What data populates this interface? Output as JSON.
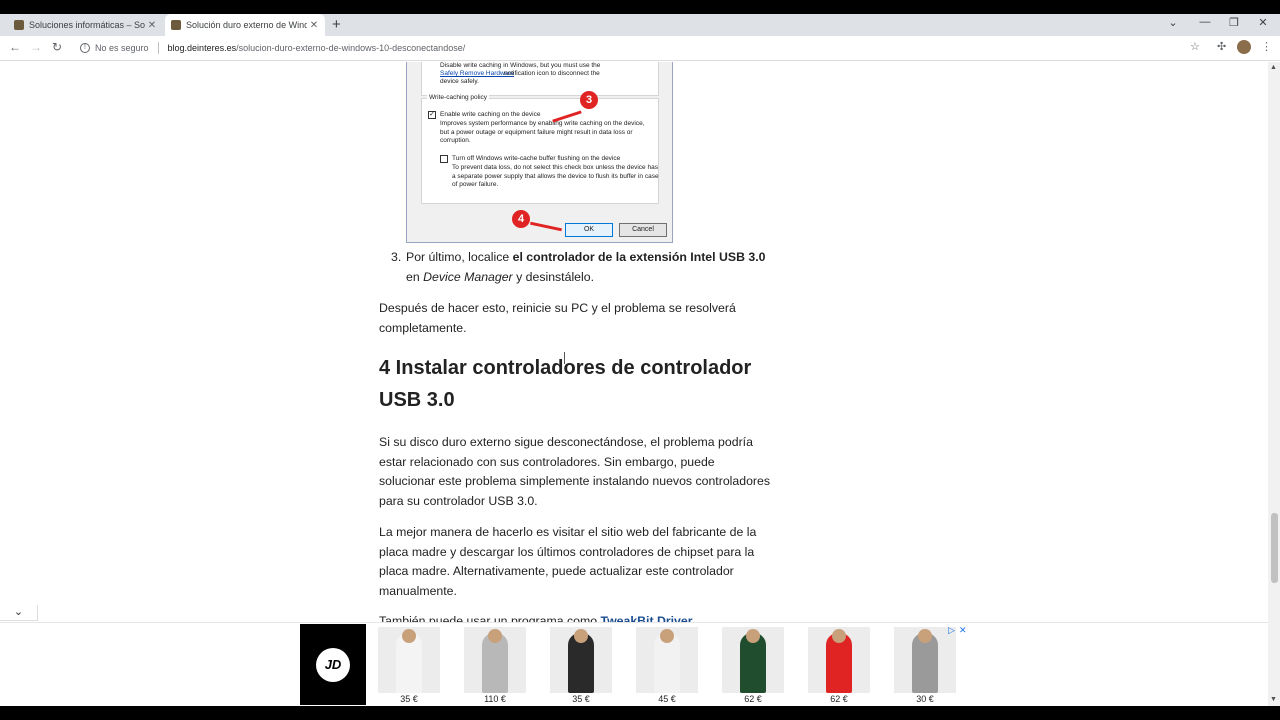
{
  "browser": {
    "tabs": [
      {
        "title": "Soluciones informáticas – Solucio"
      },
      {
        "title": "Solución duro externo de Windo"
      }
    ],
    "new_tab": "+",
    "tab_close": "✕",
    "address": {
      "security": "No es seguro",
      "host": "blog.deinteres.es",
      "path": "/solucion-duro-externo-de-windows-10-desconectandose/"
    }
  },
  "dialog": {
    "top_line1": "Disable write caching in Windows, but you must use the",
    "top_link": "Safely Remove Hardware",
    "top_link_rest": " notification icon to disconnect the",
    "top_line3": "device safely.",
    "group_label": "Write-caching policy",
    "opt1_label": "Enable write caching on the device",
    "opt1_desc": "Improves system performance by enabling write caching on the device, but a power outage or equipment failure might result in data loss or corruption.",
    "opt2_label": "Turn off Windows write-cache buffer flushing on the device",
    "opt2_desc": "To prevent data loss, do not select this check box unless the device has a separate power supply that allows the device to flush its buffer in case of power failure.",
    "ok": "OK",
    "cancel": "Cancel",
    "badge3": "3",
    "badge4": "4"
  },
  "article": {
    "step3_num": "3.",
    "step3_a": "Por último, localice ",
    "step3_b": "el controlador de la extensión Intel USB 3.0",
    "step3_c": " en ",
    "step3_d": "Device Manager",
    "step3_e": " y desinstálelo.",
    "p1": "Después de hacer esto, reinicie su PC y el problema se resolverá completamente.",
    "h2": "4 Instalar controladores de controlador USB 3.0",
    "p2": "Si su disco duro externo sigue desconectándose, el problema podría estar relacionado con sus controladores. Sin embargo, puede solucionar este problema simplemente instalando nuevos controladores para su controlador USB 3.0.",
    "p3": "La mejor manera de hacerlo es visitar el sitio web del fabricante de la placa madre y descargar los últimos controladores de chipset para la placa madre. Alternativamente, puede actualizar este controlador manualmente.",
    "p4_partial": "También puede usar un programa como",
    "p4_link": "TweakBit Driver"
  },
  "ad": {
    "logo": "JD",
    "items": [
      {
        "price": "35 €",
        "color": "#f4f4f4"
      },
      {
        "price": "110 €",
        "color": "#b8b8b8"
      },
      {
        "price": "35 €",
        "color": "#2a2a2a"
      },
      {
        "price": "45 €",
        "color": "#f2f2f2"
      },
      {
        "price": "62 €",
        "color": "#1f4d2e"
      },
      {
        "price": "62 €",
        "color": "#e02424"
      },
      {
        "price": "30 €",
        "color": "#9a9a9a"
      }
    ],
    "adchoices": "▷",
    "close": "✕"
  },
  "icons": [
    "back-icon",
    "forward-icon",
    "reload-icon",
    "warning-icon",
    "star-icon",
    "extensions-icon",
    "menu-icon",
    "chevron-down-icon"
  ]
}
